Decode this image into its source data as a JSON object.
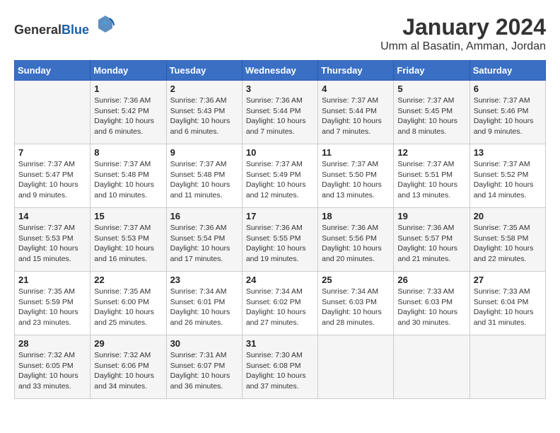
{
  "logo": {
    "general": "General",
    "blue": "Blue"
  },
  "title": "January 2024",
  "location": "Umm al Basatin, Amman, Jordan",
  "days_of_week": [
    "Sunday",
    "Monday",
    "Tuesday",
    "Wednesday",
    "Thursday",
    "Friday",
    "Saturday"
  ],
  "weeks": [
    [
      {
        "day": null
      },
      {
        "day": 1,
        "sunrise": "7:36 AM",
        "sunset": "5:42 PM",
        "daylight": "10 hours and 6 minutes."
      },
      {
        "day": 2,
        "sunrise": "7:36 AM",
        "sunset": "5:43 PM",
        "daylight": "10 hours and 6 minutes."
      },
      {
        "day": 3,
        "sunrise": "7:36 AM",
        "sunset": "5:44 PM",
        "daylight": "10 hours and 7 minutes."
      },
      {
        "day": 4,
        "sunrise": "7:37 AM",
        "sunset": "5:44 PM",
        "daylight": "10 hours and 7 minutes."
      },
      {
        "day": 5,
        "sunrise": "7:37 AM",
        "sunset": "5:45 PM",
        "daylight": "10 hours and 8 minutes."
      },
      {
        "day": 6,
        "sunrise": "7:37 AM",
        "sunset": "5:46 PM",
        "daylight": "10 hours and 9 minutes."
      }
    ],
    [
      {
        "day": 7,
        "sunrise": "7:37 AM",
        "sunset": "5:47 PM",
        "daylight": "10 hours and 9 minutes."
      },
      {
        "day": 8,
        "sunrise": "7:37 AM",
        "sunset": "5:48 PM",
        "daylight": "10 hours and 10 minutes."
      },
      {
        "day": 9,
        "sunrise": "7:37 AM",
        "sunset": "5:48 PM",
        "daylight": "10 hours and 11 minutes."
      },
      {
        "day": 10,
        "sunrise": "7:37 AM",
        "sunset": "5:49 PM",
        "daylight": "10 hours and 12 minutes."
      },
      {
        "day": 11,
        "sunrise": "7:37 AM",
        "sunset": "5:50 PM",
        "daylight": "10 hours and 13 minutes."
      },
      {
        "day": 12,
        "sunrise": "7:37 AM",
        "sunset": "5:51 PM",
        "daylight": "10 hours and 13 minutes."
      },
      {
        "day": 13,
        "sunrise": "7:37 AM",
        "sunset": "5:52 PM",
        "daylight": "10 hours and 14 minutes."
      }
    ],
    [
      {
        "day": 14,
        "sunrise": "7:37 AM",
        "sunset": "5:53 PM",
        "daylight": "10 hours and 15 minutes."
      },
      {
        "day": 15,
        "sunrise": "7:37 AM",
        "sunset": "5:53 PM",
        "daylight": "10 hours and 16 minutes."
      },
      {
        "day": 16,
        "sunrise": "7:36 AM",
        "sunset": "5:54 PM",
        "daylight": "10 hours and 17 minutes."
      },
      {
        "day": 17,
        "sunrise": "7:36 AM",
        "sunset": "5:55 PM",
        "daylight": "10 hours and 19 minutes."
      },
      {
        "day": 18,
        "sunrise": "7:36 AM",
        "sunset": "5:56 PM",
        "daylight": "10 hours and 20 minutes."
      },
      {
        "day": 19,
        "sunrise": "7:36 AM",
        "sunset": "5:57 PM",
        "daylight": "10 hours and 21 minutes."
      },
      {
        "day": 20,
        "sunrise": "7:35 AM",
        "sunset": "5:58 PM",
        "daylight": "10 hours and 22 minutes."
      }
    ],
    [
      {
        "day": 21,
        "sunrise": "7:35 AM",
        "sunset": "5:59 PM",
        "daylight": "10 hours and 23 minutes."
      },
      {
        "day": 22,
        "sunrise": "7:35 AM",
        "sunset": "6:00 PM",
        "daylight": "10 hours and 25 minutes."
      },
      {
        "day": 23,
        "sunrise": "7:34 AM",
        "sunset": "6:01 PM",
        "daylight": "10 hours and 26 minutes."
      },
      {
        "day": 24,
        "sunrise": "7:34 AM",
        "sunset": "6:02 PM",
        "daylight": "10 hours and 27 minutes."
      },
      {
        "day": 25,
        "sunrise": "7:34 AM",
        "sunset": "6:03 PM",
        "daylight": "10 hours and 28 minutes."
      },
      {
        "day": 26,
        "sunrise": "7:33 AM",
        "sunset": "6:03 PM",
        "daylight": "10 hours and 30 minutes."
      },
      {
        "day": 27,
        "sunrise": "7:33 AM",
        "sunset": "6:04 PM",
        "daylight": "10 hours and 31 minutes."
      }
    ],
    [
      {
        "day": 28,
        "sunrise": "7:32 AM",
        "sunset": "6:05 PM",
        "daylight": "10 hours and 33 minutes."
      },
      {
        "day": 29,
        "sunrise": "7:32 AM",
        "sunset": "6:06 PM",
        "daylight": "10 hours and 34 minutes."
      },
      {
        "day": 30,
        "sunrise": "7:31 AM",
        "sunset": "6:07 PM",
        "daylight": "10 hours and 36 minutes."
      },
      {
        "day": 31,
        "sunrise": "7:30 AM",
        "sunset": "6:08 PM",
        "daylight": "10 hours and 37 minutes."
      },
      {
        "day": null
      },
      {
        "day": null
      },
      {
        "day": null
      }
    ]
  ]
}
